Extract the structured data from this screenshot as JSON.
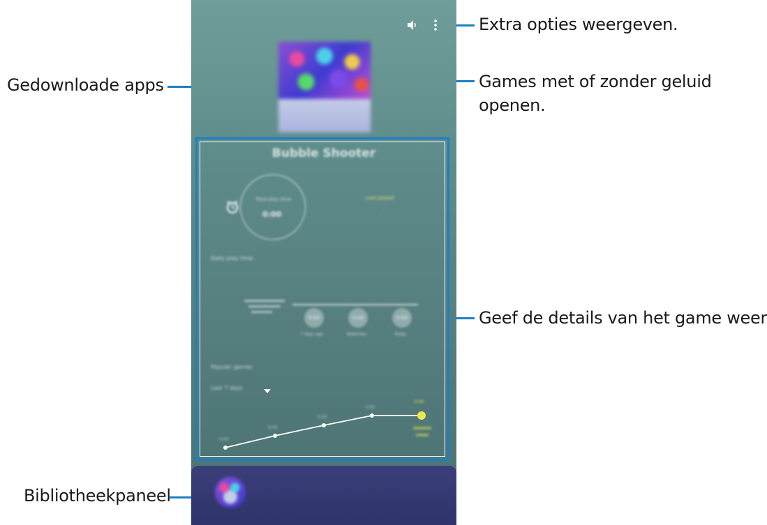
{
  "callouts": {
    "extra_options": "Extra opties weergeven.",
    "sound_line1": "Games met of zonder geluid",
    "sound_line2": "openen.",
    "downloaded_apps": "Gedownloade apps",
    "details": "Geef de details van het game weer.",
    "library_panel": "Bibliotheekpaneel"
  },
  "phone": {
    "icons": {
      "sound": "speaker-icon",
      "more": "more-options-icon",
      "alarm": "alarm-clock-icon",
      "dropdown": "dropdown-arrow-icon",
      "handle": "chevron-up-icon"
    },
    "game_title": "Bubble Shooter",
    "play_time_label": "Total play time",
    "play_time_value": "0:00",
    "last_played_label": "Last played",
    "last_played_value": "-",
    "section_play_time": "Daily play time",
    "section_genres": "Popular genres",
    "filter_value": "Last 7 days",
    "bubbles": [
      "0:00",
      "0:00",
      "0:00"
    ],
    "bubble_labels": [
      "7 days ago",
      "Yesterday",
      "Today"
    ],
    "chart_points": [
      "0:00",
      "0:00",
      "0:00",
      "0:00",
      "0:00"
    ]
  },
  "colors": {
    "callout_line": "#1b7fc4",
    "panel_bg": "#5e8c8a",
    "library_bg": "#2f336b",
    "highlight": "#f0e84a"
  }
}
